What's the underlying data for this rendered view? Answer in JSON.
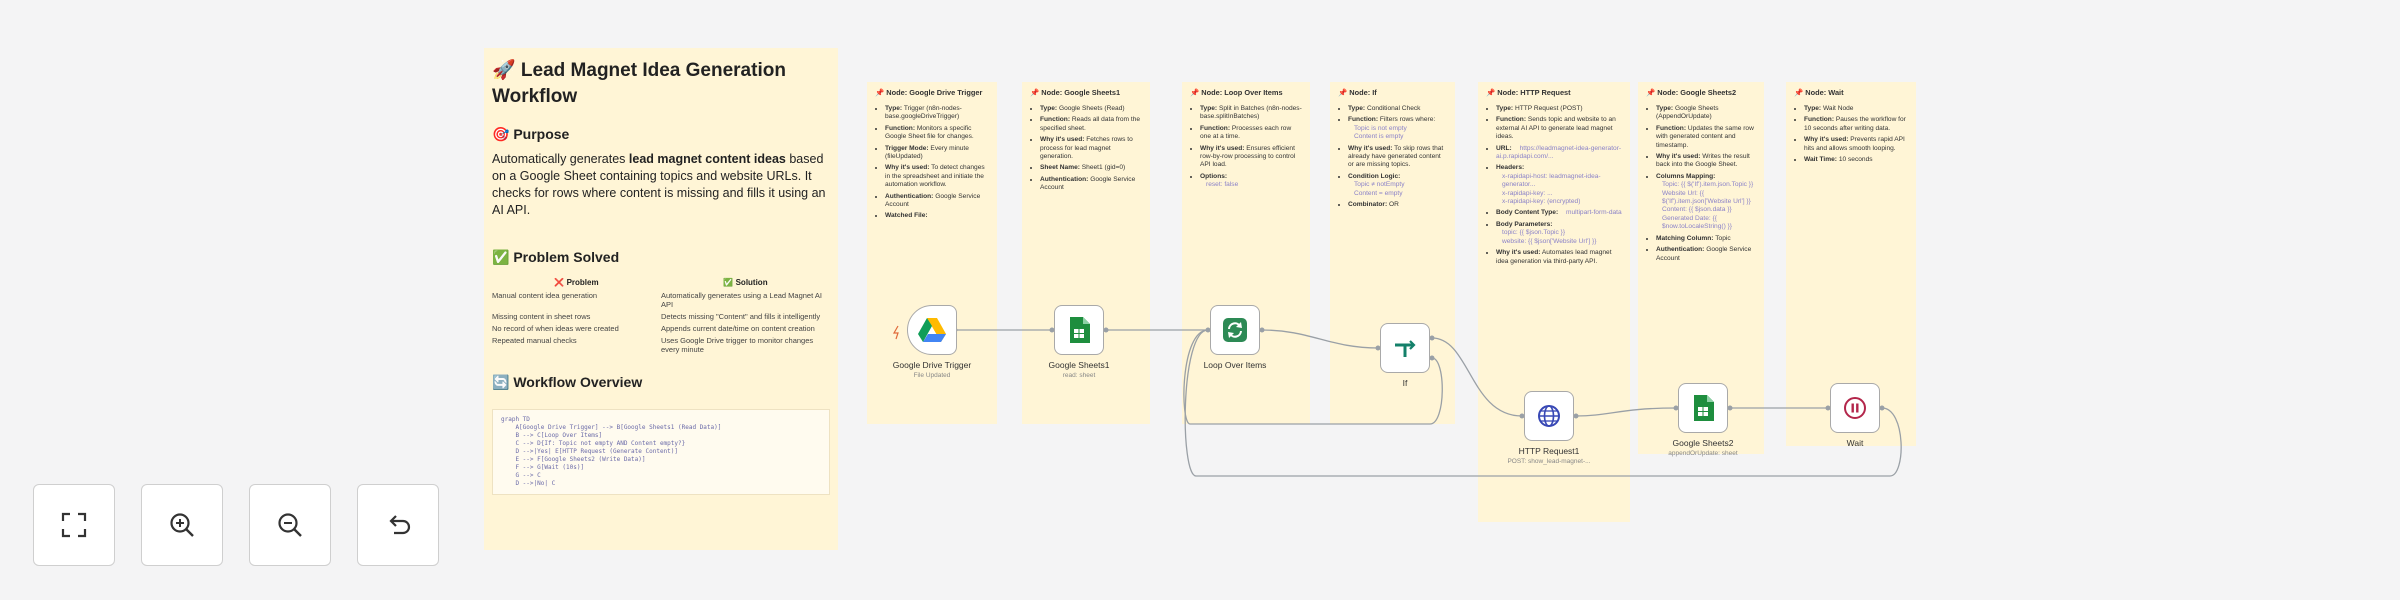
{
  "sticky_main": {
    "title": "🚀 Lead Magnet Idea Generation Workflow",
    "purpose_heading": "🎯 Purpose",
    "purpose_pre": "Automatically generates ",
    "purpose_bold": "lead magnet content ideas",
    "purpose_post": " based on a Google Sheet containing topics and website URLs. It checks for rows where content is missing and fills it using an AI API.",
    "problem_heading": "✅ Problem Solved",
    "problem_col": "❌ Problem",
    "solution_col": "✅ Solution",
    "rows": [
      {
        "problem": "Manual content idea generation",
        "solution": "Automatically generates using a Lead Magnet AI API"
      },
      {
        "problem": "Missing content in sheet rows",
        "solution": "Detects missing \"Content\" and fills it intelligently"
      },
      {
        "problem": "No record of when ideas were created",
        "solution": "Appends current date/time on content creation"
      },
      {
        "problem": "Repeated manual checks",
        "solution": "Uses Google Drive trigger to monitor changes every minute"
      }
    ],
    "overview_heading": "🔄 Workflow Overview",
    "overview_code": "graph TD\n    A[Google Drive Trigger] --> B[Google Sheets1 (Read Data)]\n    B --> C[Loop Over Items]\n    C --> D{If: Topic not empty AND Content empty?}\n    D -->|Yes| E[HTTP Request (Generate Content)]\n    E --> F[Google Sheets2 (Write Data)]\n    F --> G[Wait (10s)]\n    G --> C\n    D -->|No| C"
  },
  "node_notes": [
    {
      "title": "📌 Node: Google Drive Trigger",
      "items": [
        {
          "k": "Type:",
          "v": " Trigger (n8n-nodes-base.googleDriveTrigger)"
        },
        {
          "k": "Function:",
          "v": " Monitors a specific Google Sheet file for changes."
        },
        {
          "k": "Trigger Mode:",
          "v": " Every minute (fileUpdated)"
        },
        {
          "k": "Why it's used:",
          "v": " To detect changes in the spreadsheet and initiate the automation workflow."
        },
        {
          "k": "Authentication:",
          "v": " Google Service Account"
        },
        {
          "k": "Watched File:",
          "v": ""
        }
      ]
    },
    {
      "title": "📌 Node: Google Sheets1",
      "items": [
        {
          "k": "Type:",
          "v": " Google Sheets (Read)"
        },
        {
          "k": "Function:",
          "v": " Reads all data from the specified sheet."
        },
        {
          "k": "Why it's used:",
          "v": " Fetches rows to process for lead magnet generation."
        },
        {
          "k": "Sheet Name:",
          "v": " Sheet1 (gid=0)"
        },
        {
          "k": "Authentication:",
          "v": " Google Service Account"
        }
      ]
    },
    {
      "title": "📌 Node: Loop Over Items",
      "items": [
        {
          "k": "Type:",
          "v": " Split in Batches (n8n-nodes-base.splitInBatches)"
        },
        {
          "k": "Function:",
          "v": " Processes each row one at a time."
        },
        {
          "k": "Why it's used:",
          "v": " Ensures efficient row-by-row processing to control API load."
        },
        {
          "k": "Options:",
          "v": "",
          "sub": [
            "reset: false"
          ]
        }
      ]
    },
    {
      "title": "📌 Node: If",
      "items": [
        {
          "k": "Type:",
          "v": " Conditional Check"
        },
        {
          "k": "Function:",
          "v": " Filters rows where:",
          "sub": [
            "Topic is not empty",
            "Content is empty"
          ]
        },
        {
          "k": "Why it's used:",
          "v": " To skip rows that already have generated content or are missing topics."
        },
        {
          "k": "Condition Logic:",
          "v": "",
          "sub": [
            "Topic ≠ notEmpty",
            "Content = empty"
          ]
        },
        {
          "k": "Combinator:",
          "v": " OR"
        }
      ]
    },
    {
      "title": "📌 Node: HTTP Request",
      "items": [
        {
          "k": "Type:",
          "v": " HTTP Request (POST)"
        },
        {
          "k": "Function:",
          "v": " Sends topic and website to an external AI API to generate lead magnet ideas."
        },
        {
          "k": "URL:",
          "v": " https://leadmagnet-idea-generator-ai.p.rapidapi.com/..."
        },
        {
          "k": "Headers:",
          "v": "",
          "sub": [
            "x-rapidapi-host: leadmagnet-idea-generator...",
            "x-rapidapi-key: ...",
            "x-rapidapi-key: (encrypted)"
          ]
        },
        {
          "k": "Body Content Type:",
          "v": " multipart-form-data"
        },
        {
          "k": "Body Parameters:",
          "v": "",
          "sub": [
            "topic: {{ $json.Topic }}",
            "website: {{ $json['Website Url'] }}"
          ]
        },
        {
          "k": "Why it's used:",
          "v": " Automates lead magnet idea generation via third-party API."
        }
      ]
    },
    {
      "title": "📌 Node: Google Sheets2",
      "items": [
        {
          "k": "Type:",
          "v": " Google Sheets (AppendOrUpdate)"
        },
        {
          "k": "Function:",
          "v": " Updates the same row with generated content and timestamp."
        },
        {
          "k": "Why it's used:",
          "v": " Writes the result back into the Google Sheet."
        },
        {
          "k": "Columns Mapping:",
          "v": "",
          "sub": [
            "Topic: {{ $('If').item.json.Topic }}",
            "Website Url: {{ $('If').item.json['Website Url'] }}",
            "Content: {{ $json.data }}",
            "Generated Date: {{ $now.toLocaleString() }}"
          ]
        },
        {
          "k": "Matching Column:",
          "v": " Topic"
        },
        {
          "k": "Authentication:",
          "v": " Google Service Account"
        }
      ]
    },
    {
      "title": "📌 Node: Wait",
      "items": [
        {
          "k": "Type:",
          "v": " Wait Node"
        },
        {
          "k": "Function:",
          "v": " Pauses the workflow for 10 seconds after writing data."
        },
        {
          "k": "Why it's used:",
          "v": " Prevents rapid API hits and allows smooth looping."
        },
        {
          "k": "Wait Time:",
          "v": " 10 seconds"
        }
      ]
    }
  ],
  "nodes": [
    {
      "id": "drive",
      "label": "Google Drive Trigger",
      "sub": "File Updated",
      "icon": "google-drive-icon"
    },
    {
      "id": "sheets1",
      "label": "Google Sheets1",
      "sub": "read: sheet",
      "icon": "google-sheets-icon"
    },
    {
      "id": "loop",
      "label": "Loop Over Items",
      "sub": "",
      "icon": "loop-icon"
    },
    {
      "id": "if",
      "label": "If",
      "sub": "",
      "icon": "if-branch-icon"
    },
    {
      "id": "http",
      "label": "HTTP Request1",
      "sub": "POST: show_lead-magnet-...",
      "icon": "globe-icon"
    },
    {
      "id": "sheets2",
      "label": "Google Sheets2",
      "sub": "appendOrUpdate: sheet",
      "icon": "google-sheets-icon"
    },
    {
      "id": "wait",
      "label": "Wait",
      "sub": "",
      "icon": "pause-icon"
    }
  ],
  "colors": {
    "sticky": "#fff5d6",
    "canvas": "#f4f4f5",
    "wire": "#9aa0a6",
    "sheets_green": "#1e8e3e",
    "loop_green": "#2d8a55",
    "if_green": "#14806a",
    "http_blue": "#3848b5",
    "wait_red": "#b3264b"
  },
  "controls": [
    {
      "name": "fit-view-button",
      "icon": "fit-view-icon"
    },
    {
      "name": "zoom-in-button",
      "icon": "zoom-in-icon"
    },
    {
      "name": "zoom-out-button",
      "icon": "zoom-out-icon"
    },
    {
      "name": "reset-zoom-button",
      "icon": "undo-icon"
    }
  ]
}
